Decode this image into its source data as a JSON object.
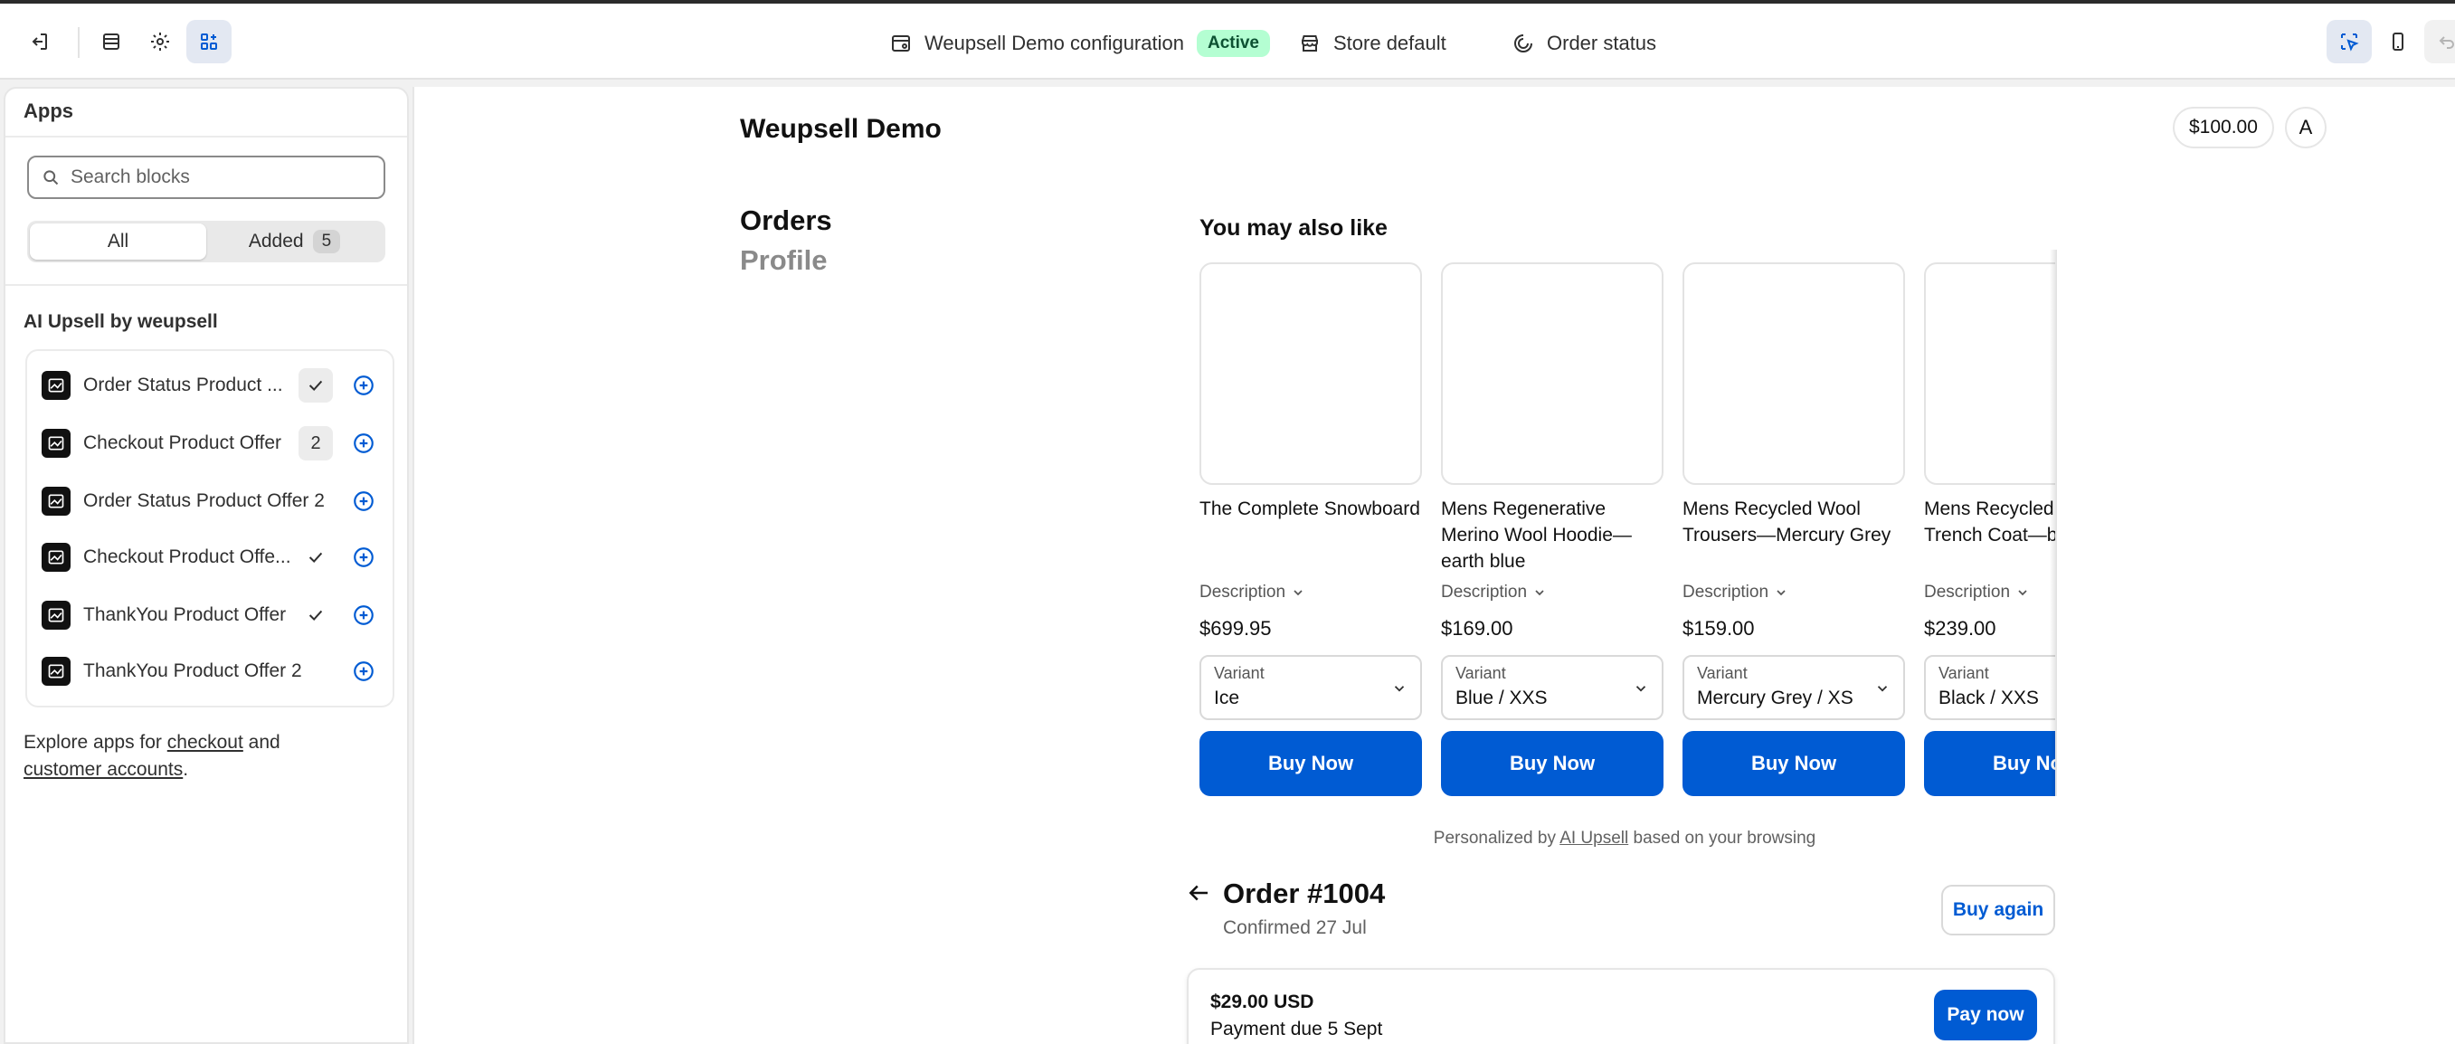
{
  "topbar": {
    "config_name": "Weupsell Demo configuration",
    "status_badge": "Active",
    "store": "Store default",
    "page": "Order status"
  },
  "sidebar": {
    "title": "Apps",
    "search_placeholder": "Search blocks",
    "filter": {
      "all_label": "All",
      "added_label": "Added",
      "added_count": "5"
    },
    "section_title": "AI Upsell by weupsell",
    "apps": [
      {
        "name": "Order Status Product ...",
        "status": "check-boxed"
      },
      {
        "name": "Checkout Product Offer",
        "status": "2"
      },
      {
        "name": "Order Status Product Offer 2",
        "status": ""
      },
      {
        "name": "Checkout Product Offe...",
        "status": "check"
      },
      {
        "name": "ThankYou Product Offer",
        "status": "check"
      },
      {
        "name": "ThankYou Product Offer 2",
        "status": ""
      }
    ],
    "explore": {
      "prefix": "Explore apps for ",
      "link1": "checkout",
      "middle": " and",
      "link2": "customer accounts",
      "suffix": "."
    }
  },
  "shop": {
    "title": "Weupsell Demo",
    "balance": "$100.00",
    "avatar_initial": "A",
    "nav": {
      "orders": "Orders",
      "profile": "Profile"
    }
  },
  "upsell": {
    "title": "You may also like",
    "description_label": "Description",
    "variant_label": "Variant",
    "buy_label": "Buy Now",
    "products": [
      {
        "title": "The Complete Snowboard",
        "price": "$699.95",
        "variant": "Ice"
      },
      {
        "title": "Mens Regenerative Merino Wool Hoodie—earth blue",
        "price": "$169.00",
        "variant": "Blue / XXS"
      },
      {
        "title": "Mens Recycled Wool Trousers—Mercury Grey",
        "price": "$159.00",
        "variant": "Mercury Grey / XS"
      },
      {
        "title": "Mens Recycled Wool Trench Coat—black",
        "price": "$239.00",
        "variant": "Black / XXS"
      }
    ],
    "personalized": {
      "prefix": "Personalized by ",
      "link": "AI Upsell",
      "suffix": " based on your browsing"
    }
  },
  "order": {
    "title": "Order #1004",
    "confirmed": "Confirmed 27 Jul",
    "buy_again": "Buy again",
    "amount": "$29.00 USD",
    "due": "Payment due 5 Sept",
    "pay_now": "Pay now"
  },
  "colors": {
    "primary": "#005bd3",
    "active_badge_bg": "#b4fed2",
    "active_badge_text": "#0c5132"
  }
}
